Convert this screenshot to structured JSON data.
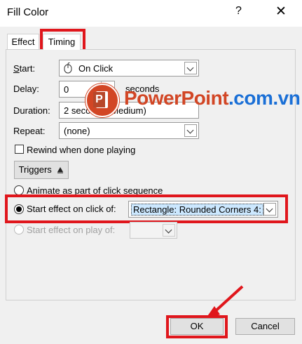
{
  "window": {
    "title": "Fill Color",
    "help_label": "?",
    "close_label": "✕"
  },
  "tabs": [
    {
      "label": "Effect"
    },
    {
      "label": "Timing"
    }
  ],
  "timing": {
    "start": {
      "label": "Start:",
      "value": "On Click",
      "icon": "mouse-icon"
    },
    "delay": {
      "label": "Delay:",
      "value": "0",
      "unit": "seconds"
    },
    "duration": {
      "label": "Duration:",
      "value": "2 seconds (Medium)"
    },
    "repeat": {
      "label": "Repeat:",
      "value": "(none)"
    },
    "rewind": {
      "label": "Rewind when done playing",
      "checked": false
    },
    "triggers": {
      "label": "Triggers",
      "icon": "triangle-up-icon"
    },
    "options": [
      {
        "label": "Animate as part of click sequence",
        "selected": false
      },
      {
        "label": "Start effect on click of:",
        "selected": true,
        "value": "Rectangle: Rounded Corners 4:"
      },
      {
        "label": "Start effect on play of:",
        "selected": false,
        "disabled": true
      }
    ]
  },
  "buttons": {
    "ok": "OK",
    "cancel": "Cancel"
  },
  "watermark": {
    "text_a": "PowerPoint",
    "text_b": ".com.vn"
  },
  "colors": {
    "highlight": "#e0161c",
    "selection": "#cce8ff",
    "brand_orange": "#d24625",
    "brand_blue": "#1a6fd6"
  }
}
